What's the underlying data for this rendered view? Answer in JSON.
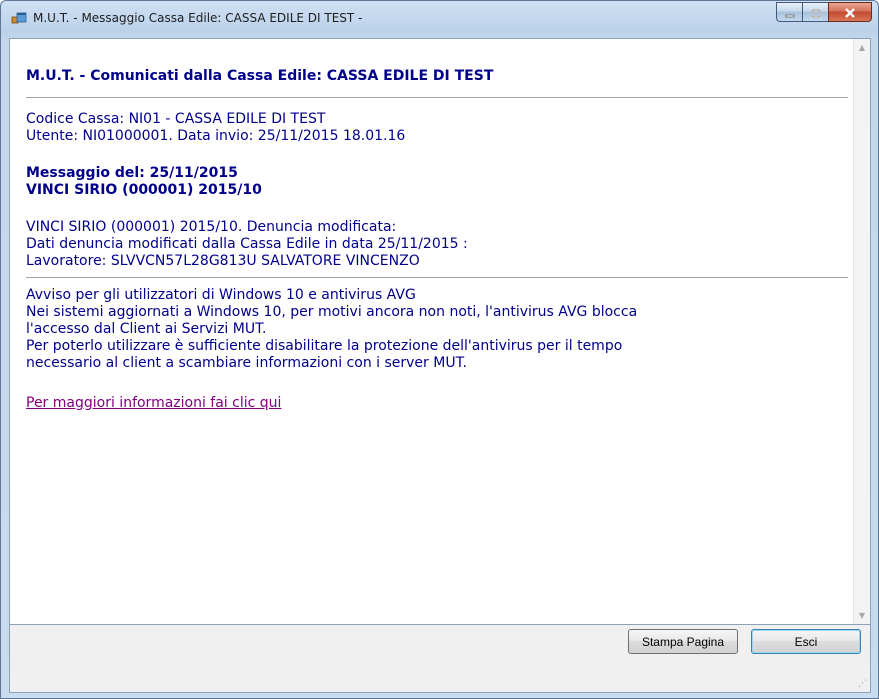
{
  "window": {
    "title": "M.U.T. - Messaggio Cassa Edile: CASSA EDILE DI TEST -",
    "icon": "app-window-icon",
    "caption_buttons": [
      "minimize-icon",
      "maximize-icon",
      "close-icon"
    ]
  },
  "message": {
    "heading": "M.U.T. - Comunicati dalla Cassa Edile: CASSA EDILE DI TEST",
    "codice_cassa": "Codice Cassa: NI01 - CASSA EDILE DI TEST",
    "utente": "Utente: NI01000001. Data invio: 25/11/2015 18.01.16",
    "messaggio_del": "Messaggio del: 25/11/2015",
    "soggetto": "VINCI SIRIO (000001) 2015/10",
    "body_lines": [
      "VINCI SIRIO (000001) 2015/10. Denuncia modificata:",
      "Dati denuncia modificati dalla Cassa Edile in data 25/11/2015 :",
      "Lavoratore: SLVVCN57L28G813U SALVATORE VINCENZO"
    ],
    "avviso_lines": [
      "Avviso per gli utilizzatori di Windows 10 e antivirus AVG",
      "Nei sistemi aggiornati a Windows 10, per motivi ancora non noti, l'antivirus AVG blocca",
      "l'accesso dal Client ai Servizi MUT.",
      "Per poterlo utilizzare è sufficiente disabilitare la protezione dell'antivirus per il tempo",
      "necessario al client a scambiare informazioni con i server MUT."
    ],
    "link_text": "Per maggiori informazioni fai clic qui"
  },
  "buttons": {
    "print_label": "Stampa Pagina",
    "exit_label": "Esci"
  },
  "colors": {
    "text": "#00008b",
    "link": "#800080"
  }
}
